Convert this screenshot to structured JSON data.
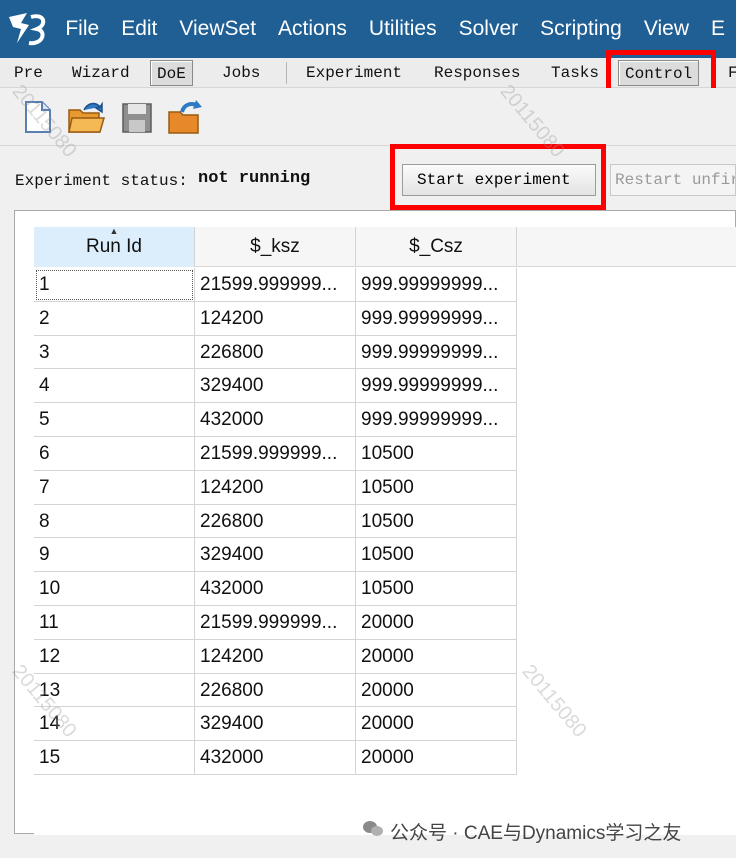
{
  "menubar": {
    "items": [
      "File",
      "Edit",
      "ViewSet",
      "Actions",
      "Utilities",
      "Solver",
      "Scripting",
      "View",
      "E"
    ]
  },
  "tabbar": {
    "left_tabs": [
      "Pre",
      "Wizard",
      "DoE",
      "Jobs"
    ],
    "right_tabs": [
      "Experiment",
      "Responses",
      "Tasks",
      "Control",
      "F"
    ],
    "active_left": "DoE",
    "active_right": "Control"
  },
  "toolbar": {
    "icons": [
      "new-file-icon",
      "open-folder-icon",
      "save-icon",
      "import-folder-icon"
    ]
  },
  "status": {
    "label": "Experiment status:",
    "value": "not running",
    "start_button": "Start experiment",
    "restart_button": "Restart unfir"
  },
  "table": {
    "columns": [
      "Run Id",
      "$_ksz",
      "$_Csz"
    ],
    "rows": [
      [
        "1",
        "21599.999999...",
        "999.99999999..."
      ],
      [
        "2",
        "124200",
        "999.99999999..."
      ],
      [
        "3",
        "226800",
        "999.99999999..."
      ],
      [
        "4",
        "329400",
        "999.99999999..."
      ],
      [
        "5",
        "432000",
        "999.99999999..."
      ],
      [
        "6",
        "21599.999999...",
        "10500"
      ],
      [
        "7",
        "124200",
        "10500"
      ],
      [
        "8",
        "226800",
        "10500"
      ],
      [
        "9",
        "329400",
        "10500"
      ],
      [
        "10",
        "432000",
        "10500"
      ],
      [
        "11",
        "21599.999999...",
        "20000"
      ],
      [
        "12",
        "124200",
        "20000"
      ],
      [
        "13",
        "226800",
        "20000"
      ],
      [
        "14",
        "329400",
        "20000"
      ],
      [
        "15",
        "432000",
        "20000"
      ]
    ]
  },
  "watermark": "20115080",
  "credit": "公众号 · CAE与Dynamics学习之友",
  "colors": {
    "menubar": "#1f5f94",
    "highlight": "#ff0000",
    "header_sorted": "#dceefb"
  }
}
